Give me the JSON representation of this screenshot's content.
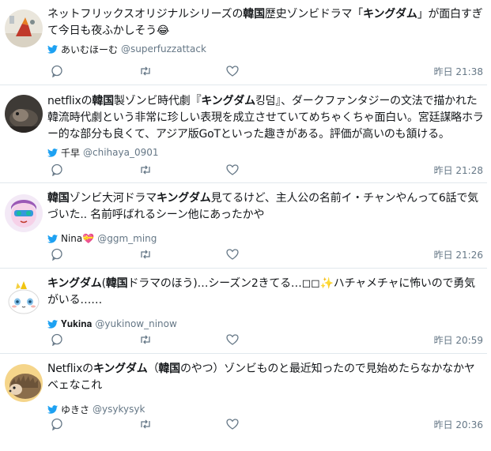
{
  "tweets": [
    {
      "text": [
        {
          "t": "ネットフリックスオリジナルシリーズの",
          "b": false
        },
        {
          "t": "韓国",
          "b": true
        },
        {
          "t": "歴史ゾンビドラマ「",
          "b": false
        },
        {
          "t": "キングダム",
          "b": true
        },
        {
          "t": "」が面白すぎて今日も夜ふかしそう😂",
          "b": false
        }
      ],
      "name": "あいむほーむ",
      "handle": "@superfuzzattack",
      "time": "昨日 21:38",
      "avatar": "avatar-1"
    },
    {
      "text": [
        {
          "t": "netflixの",
          "b": false
        },
        {
          "t": "韓国",
          "b": true
        },
        {
          "t": "製ゾンビ時代劇『",
          "b": false
        },
        {
          "t": "キングダム",
          "b": true
        },
        {
          "t": "킹덤』、ダークファンタジーの文法で描かれた韓流時代劇という非常に珍しい表現を成立させていてめちゃくちゃ面白い。宮廷謀略ホラー的な部分も良くて、アジア版GoTといった趣きがある。評価が高いのも頷ける。",
          "b": false
        }
      ],
      "name": "千早",
      "handle": "@chihaya_0901",
      "time": "昨日 21:28",
      "avatar": "avatar-2"
    },
    {
      "text": [
        {
          "t": "韓国",
          "b": true
        },
        {
          "t": "ゾンビ大河ドラマ",
          "b": false
        },
        {
          "t": "キングダム",
          "b": true
        },
        {
          "t": "見てるけど、主人公の名前イ・チャンやんって6話で気づいた.. 名前呼ばれるシーン他にあったかや",
          "b": false
        }
      ],
      "name": "Nina💝",
      "handle": "@ggm_ming",
      "time": "昨日 21:26",
      "avatar": "avatar-3"
    },
    {
      "text": [
        {
          "t": "キングダム",
          "b": true
        },
        {
          "t": "(",
          "b": false
        },
        {
          "t": "韓国",
          "b": true
        },
        {
          "t": "ドラマのほう)…シーズン2きてる…◻◻✨ハチャメチャに怖いので勇気がいる……",
          "b": false
        }
      ],
      "name": "𝐘𝐮𝐤𝐢𝐧𝐚",
      "handle": "@yukinow_ninow",
      "time": "昨日 20:59",
      "avatar": "avatar-4"
    },
    {
      "text": [
        {
          "t": "Netflixの",
          "b": false
        },
        {
          "t": "キングダム",
          "b": true
        },
        {
          "t": "（",
          "b": false
        },
        {
          "t": "韓国",
          "b": true
        },
        {
          "t": "のやつ）ゾンビものと最近知ったので見始めたらなかなかヤベェなこれ",
          "b": false
        }
      ],
      "name": "ゆきさ",
      "handle": "@ysykysyk",
      "time": "昨日 20:36",
      "avatar": "avatar-5"
    }
  ],
  "icons": {
    "bird": "twitter-bird-icon",
    "reply": "reply-icon",
    "retweet": "retweet-icon",
    "like": "heart-icon"
  },
  "colors": {
    "bird": "#1da1f2",
    "muted": "#657786",
    "text": "#14171a",
    "divider": "#e1e8ed"
  }
}
